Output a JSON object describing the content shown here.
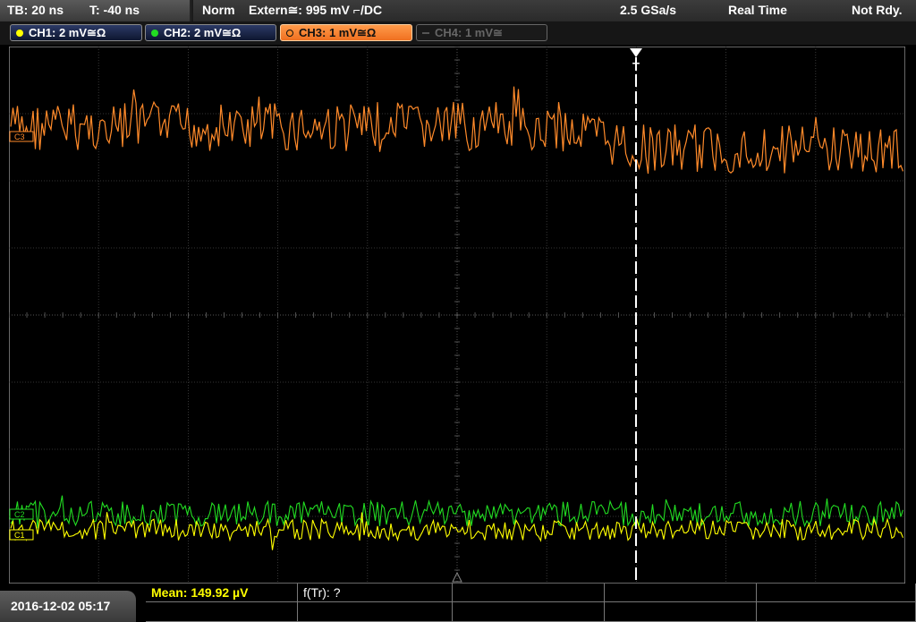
{
  "status_bar": {
    "timebase": "TB: 20 ns",
    "trigger_time": "T: -40 ns",
    "trigger_mode": "Norm",
    "trigger_source": "Extern≅: 995 mV ⌐/DC",
    "sample_rate": "2.5 GSa/s",
    "acquisition": "Real Time",
    "state": "Not Rdy."
  },
  "channels": [
    {
      "label": "CH1: 2 mV≅Ω",
      "color": "#ffff00",
      "active": false,
      "enabled": true
    },
    {
      "label": "CH2: 2 mV≅Ω",
      "color": "#22dd22",
      "active": false,
      "enabled": true
    },
    {
      "label": "CH3: 1 mV≅Ω",
      "color": "#ff8a2a",
      "active": true,
      "enabled": true
    },
    {
      "label": "CH4: 1 mV≅",
      "color": "#666666",
      "active": false,
      "enabled": false
    }
  ],
  "markers": {
    "ch3": "C3",
    "ch2": "C2",
    "ch1": "C1",
    "trigger": "T"
  },
  "colors": {
    "ch1": "#ffff00",
    "ch2": "#22dd22",
    "ch3": "#ff8a2a",
    "grid": "#444444"
  },
  "datetime": "2016-12-02 05:17",
  "measurements": {
    "mean": "Mean: 149.92 µV",
    "freq": "f(Tr): ?"
  }
}
